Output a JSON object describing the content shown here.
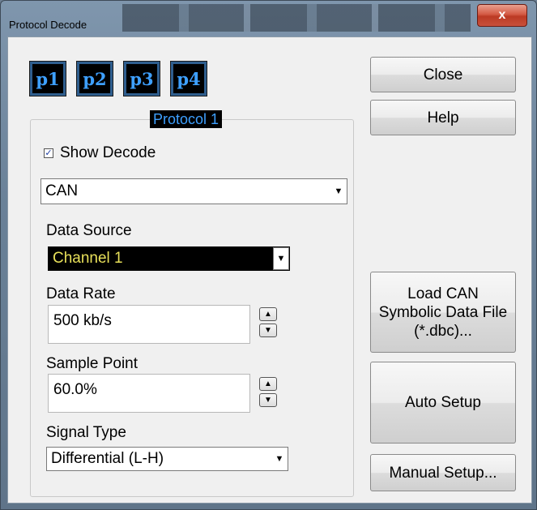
{
  "window": {
    "title": "Protocol Decode",
    "close_glyph": "x"
  },
  "protocol_tabs": [
    "p1",
    "p2",
    "p3",
    "p4"
  ],
  "group": {
    "title": "Protocol 1",
    "show_decode": {
      "label": "Show Decode",
      "checked": true,
      "check_glyph": "✓"
    },
    "protocol_select": {
      "value": "CAN"
    },
    "data_source": {
      "label": "Data Source",
      "value": "Channel 1"
    },
    "data_rate": {
      "label": "Data Rate",
      "value": "500 kb/s"
    },
    "sample_point": {
      "label": "Sample Point",
      "value": "60.0%"
    },
    "signal_type": {
      "label": "Signal Type",
      "value": "Differential (L-H)"
    }
  },
  "buttons": {
    "close": "Close",
    "help": "Help",
    "load_can": "Load CAN Symbolic Data File (*.dbc)...",
    "auto_setup": "Auto Setup",
    "manual_setup": "Manual Setup..."
  },
  "glyphs": {
    "dropdown": "▼",
    "spin_up": "▲",
    "spin_down": "▼"
  }
}
